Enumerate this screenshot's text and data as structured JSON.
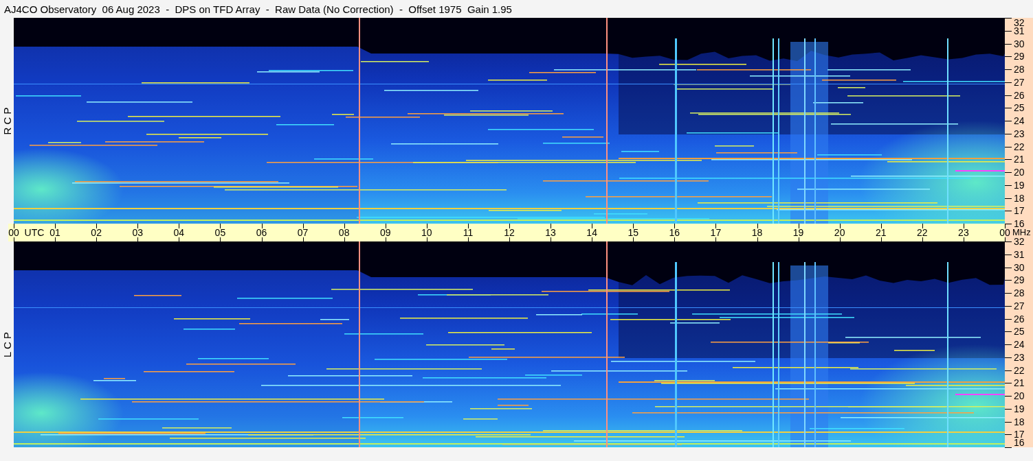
{
  "title": "AJ4CO Observatory  06 Aug 2023  -  DPS on TFD Array  -  Raw Data (No Correction)  -  Offset 1975  Gain 1.95",
  "panels": [
    {
      "label": "R C P",
      "kind": "spectrogram",
      "frequency_ticks": [
        "32",
        "31",
        "30",
        "29",
        "28",
        "27",
        "26",
        "25",
        "24",
        "23",
        "22",
        "21",
        "20",
        "19",
        "18",
        "17",
        "16"
      ]
    },
    {
      "label": "L C P",
      "kind": "spectrogram",
      "frequency_ticks": [
        "32",
        "31",
        "30",
        "29",
        "28",
        "27",
        "26",
        "25",
        "24",
        "23",
        "22",
        "21",
        "20",
        "19",
        "18",
        "17",
        "16"
      ]
    }
  ],
  "time_axis": {
    "ticks": [
      "00",
      "01",
      "02",
      "03",
      "04",
      "05",
      "06",
      "07",
      "08",
      "09",
      "10",
      "11",
      "12",
      "13",
      "14",
      "15",
      "16",
      "17",
      "18",
      "19",
      "20",
      "21",
      "22",
      "23",
      "00"
    ],
    "zone": "UTC",
    "frequency_unit": "MHz"
  }
}
